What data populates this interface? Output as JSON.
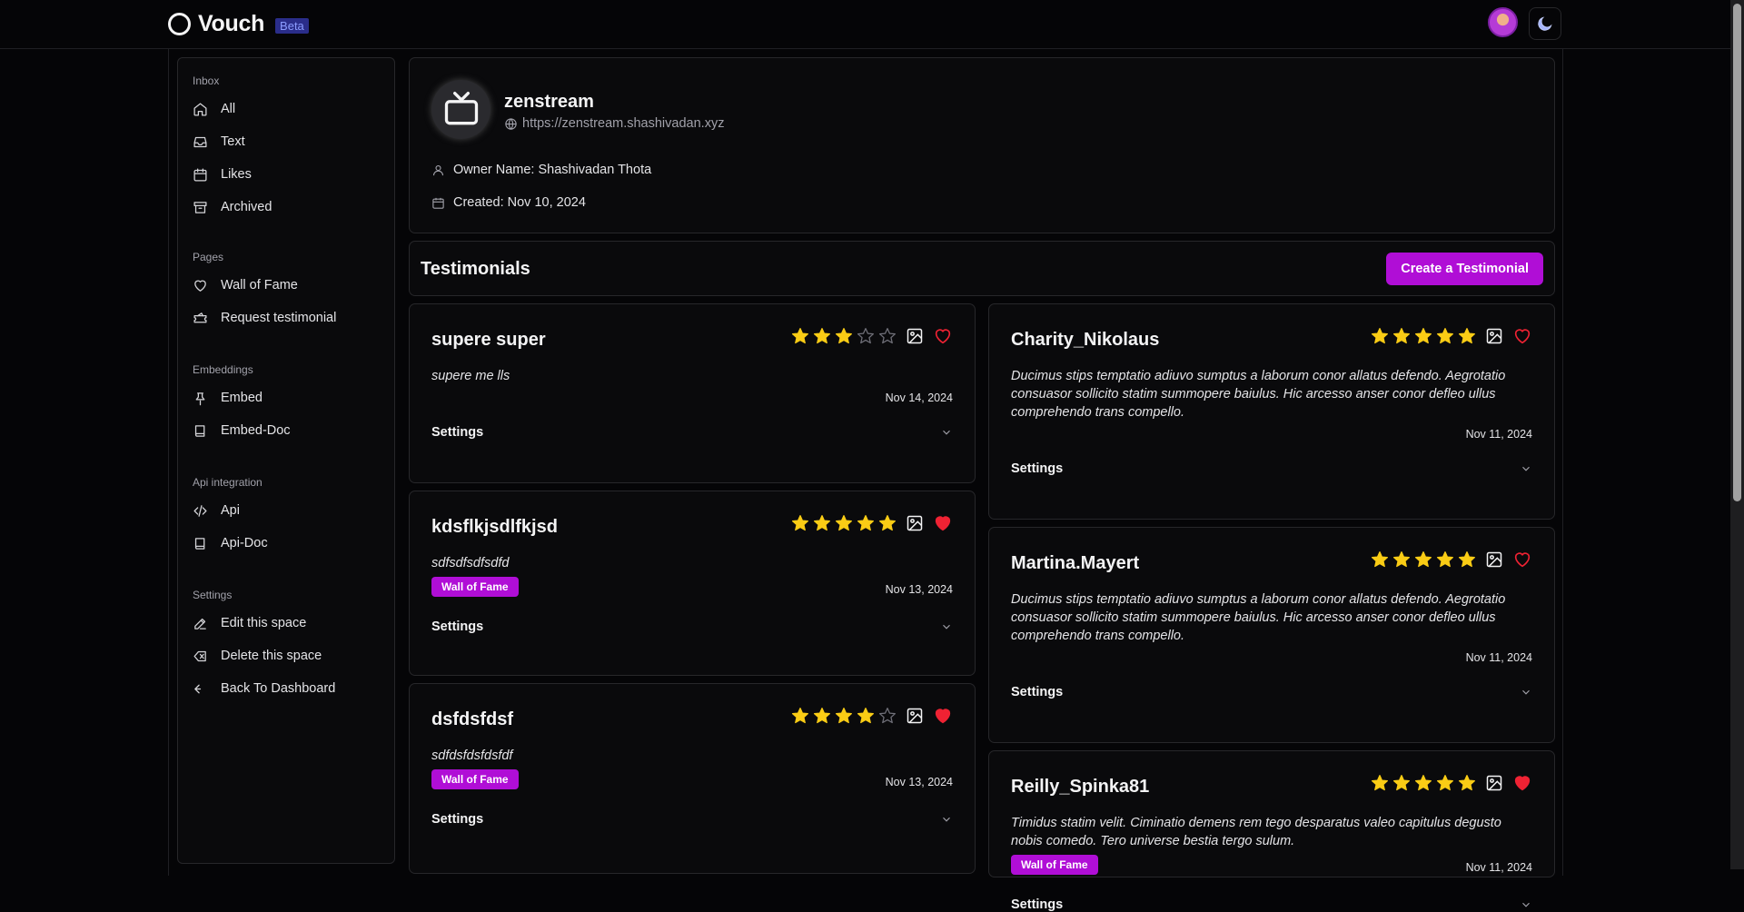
{
  "app": {
    "name": "Vouch",
    "badge": "Beta"
  },
  "sidebar": {
    "sections": [
      {
        "title": "Inbox",
        "items": [
          {
            "label": "All",
            "icon": "home-icon"
          },
          {
            "label": "Text",
            "icon": "inbox-icon"
          },
          {
            "label": "Likes",
            "icon": "calendar-icon"
          },
          {
            "label": "Archived",
            "icon": "archive-icon"
          }
        ]
      },
      {
        "title": "Pages",
        "items": [
          {
            "label": "Wall of Fame",
            "icon": "heart-icon"
          },
          {
            "label": "Request testimonial",
            "icon": "ticket-icon"
          }
        ]
      },
      {
        "title": "Embeddings",
        "items": [
          {
            "label": "Embed",
            "icon": "pin-icon"
          },
          {
            "label": "Embed-Doc",
            "icon": "book-icon"
          }
        ]
      },
      {
        "title": "Api integration",
        "items": [
          {
            "label": "Api",
            "icon": "code-icon"
          },
          {
            "label": "Api-Doc",
            "icon": "book-icon"
          }
        ]
      },
      {
        "title": "Settings",
        "items": [
          {
            "label": "Edit this space",
            "icon": "edit-icon"
          },
          {
            "label": "Delete this space",
            "icon": "delete-icon"
          },
          {
            "label": "Back To Dashboard",
            "icon": "back-icon"
          }
        ]
      }
    ]
  },
  "space": {
    "name": "zenstream",
    "url": "https://zenstream.shashivadan.xyz",
    "owner": "Owner Name: Shashivadan Thota",
    "created": "Created: Nov 10, 2024"
  },
  "testimonials_header": {
    "title": "Testimonials",
    "create_label": "Create a Testimonial"
  },
  "testimonials": [
    {
      "name": "supere super",
      "rating": 3,
      "liked": false,
      "text": "supere me lls",
      "badge": "",
      "date": "Nov 14, 2024",
      "settings": "Settings"
    },
    {
      "name": "kdsflkjsdlfkjsd",
      "rating": 5,
      "liked": true,
      "text": "sdfsdfsdfsdfd",
      "badge": "Wall of Fame",
      "date": "Nov 13, 2024",
      "settings": "Settings"
    },
    {
      "name": "dsfdsfdsf",
      "rating": 4,
      "liked": true,
      "text": "sdfdsfdsfdsfdf",
      "badge": "Wall of Fame",
      "date": "Nov 13, 2024",
      "settings": "Settings"
    },
    {
      "name": "Charity_Nikolaus",
      "rating": 5,
      "liked": false,
      "text": "Ducimus stips temptatio adiuvo sumptus a laborum conor allatus defendo. Aegrotatio consuasor sollicito statim summopere baiulus. Hic arcesso anser conor defleo ullus comprehendo trans compello.",
      "badge": "",
      "date": "Nov 11, 2024",
      "settings": "Settings"
    },
    {
      "name": "Martina.Mayert",
      "rating": 5,
      "liked": false,
      "text": "Ducimus stips temptatio adiuvo sumptus a laborum conor allatus defendo. Aegrotatio consuasor sollicito statim summopere baiulus. Hic arcesso anser conor defleo ullus comprehendo trans compello.",
      "badge": "",
      "date": "Nov 11, 2024",
      "settings": "Settings"
    },
    {
      "name": "Reilly_Spinka81",
      "rating": 5,
      "liked": true,
      "text": "Timidus statim velit. Ciminatio demens rem tego desparatus valeo capitulus degusto nobis comedo. Tero universe bestia tergo sulum.",
      "badge": "Wall of Fame",
      "date": "Nov 11, 2024",
      "settings": "Settings"
    }
  ],
  "colors": {
    "accent": "#b00ed6",
    "star": "#facc15",
    "heart": "#ef2233",
    "background": "#050507"
  }
}
